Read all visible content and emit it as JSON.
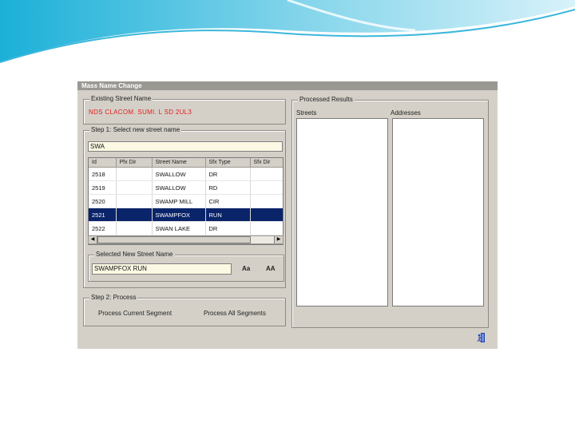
{
  "window": {
    "title": "Mass Name Change"
  },
  "existing": {
    "legend": "Existing Street Name",
    "value": "NDS CLACOM. SUMI. L SD 2UL3"
  },
  "step1": {
    "legend": "Step 1: Select new street name",
    "search_value": "SWA",
    "columns": [
      "Id",
      "Pfx Dir",
      "Street Name",
      "Sfx Type",
      "Sfx Dir"
    ],
    "rows": [
      {
        "id": "2518",
        "pfx": "",
        "name": "SWALLOW",
        "type": "DR",
        "sfx": ""
      },
      {
        "id": "2519",
        "pfx": "",
        "name": "SWALLOW",
        "type": "RD",
        "sfx": ""
      },
      {
        "id": "2520",
        "pfx": "",
        "name": "SWAMP MILL",
        "type": "CIR",
        "sfx": ""
      },
      {
        "id": "2521",
        "pfx": "",
        "name": "SWAMPFOX",
        "type": "RUN",
        "sfx": ""
      },
      {
        "id": "2522",
        "pfx": "",
        "name": "SWAN LAKE",
        "type": "DR",
        "sfx": ""
      }
    ],
    "selected_row": 3
  },
  "selected": {
    "legend": "Selected New Street Name",
    "value": "SWAMPFOX RUN",
    "case_lower": "Aa",
    "case_upper": "AA"
  },
  "step2": {
    "legend": "Step 2: Process",
    "current": "Process Current Segment",
    "all": "Process All Segments"
  },
  "results": {
    "legend": "Processed Results",
    "streets_label": "Streets",
    "addresses_label": "Addresses"
  },
  "colors": {
    "selection": "#0a246a",
    "field": "#fbf9e3",
    "dialog": "#d4d0c8",
    "error_text": "#e02020"
  }
}
